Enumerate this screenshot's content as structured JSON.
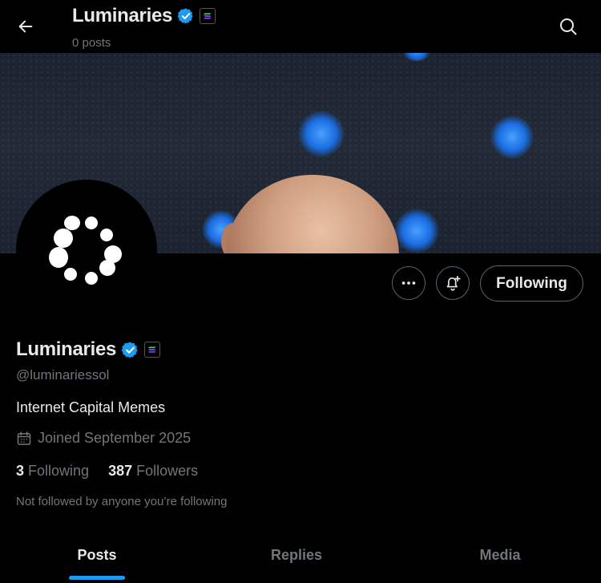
{
  "header": {
    "title": "Luminaries",
    "post_count": "0 posts"
  },
  "profile": {
    "name": "Luminaries",
    "handle": "@luminariessol",
    "bio": "Internet Capital Memes",
    "joined": "Joined September 2025",
    "following_count": "3",
    "following_label": "Following",
    "followers_count": "387",
    "followers_label": "Followers",
    "not_followed_text": "Not followed by anyone you’re following",
    "verified_icon": "verified-badge-icon",
    "affiliate_icon": "solana-badge-icon"
  },
  "actions": {
    "follow_label": "Following",
    "more_icon": "more-icon",
    "notify_icon": "bell-plus-icon"
  },
  "tabs": [
    {
      "label": "Posts",
      "active": true
    },
    {
      "label": "Replies",
      "active": false
    },
    {
      "label": "Media",
      "active": false
    }
  ],
  "colors": {
    "accent": "#1d9bf0",
    "verified": "#1d9bf0",
    "background": "#000000",
    "text_primary": "#e7e9ea",
    "text_secondary": "#71767b"
  }
}
